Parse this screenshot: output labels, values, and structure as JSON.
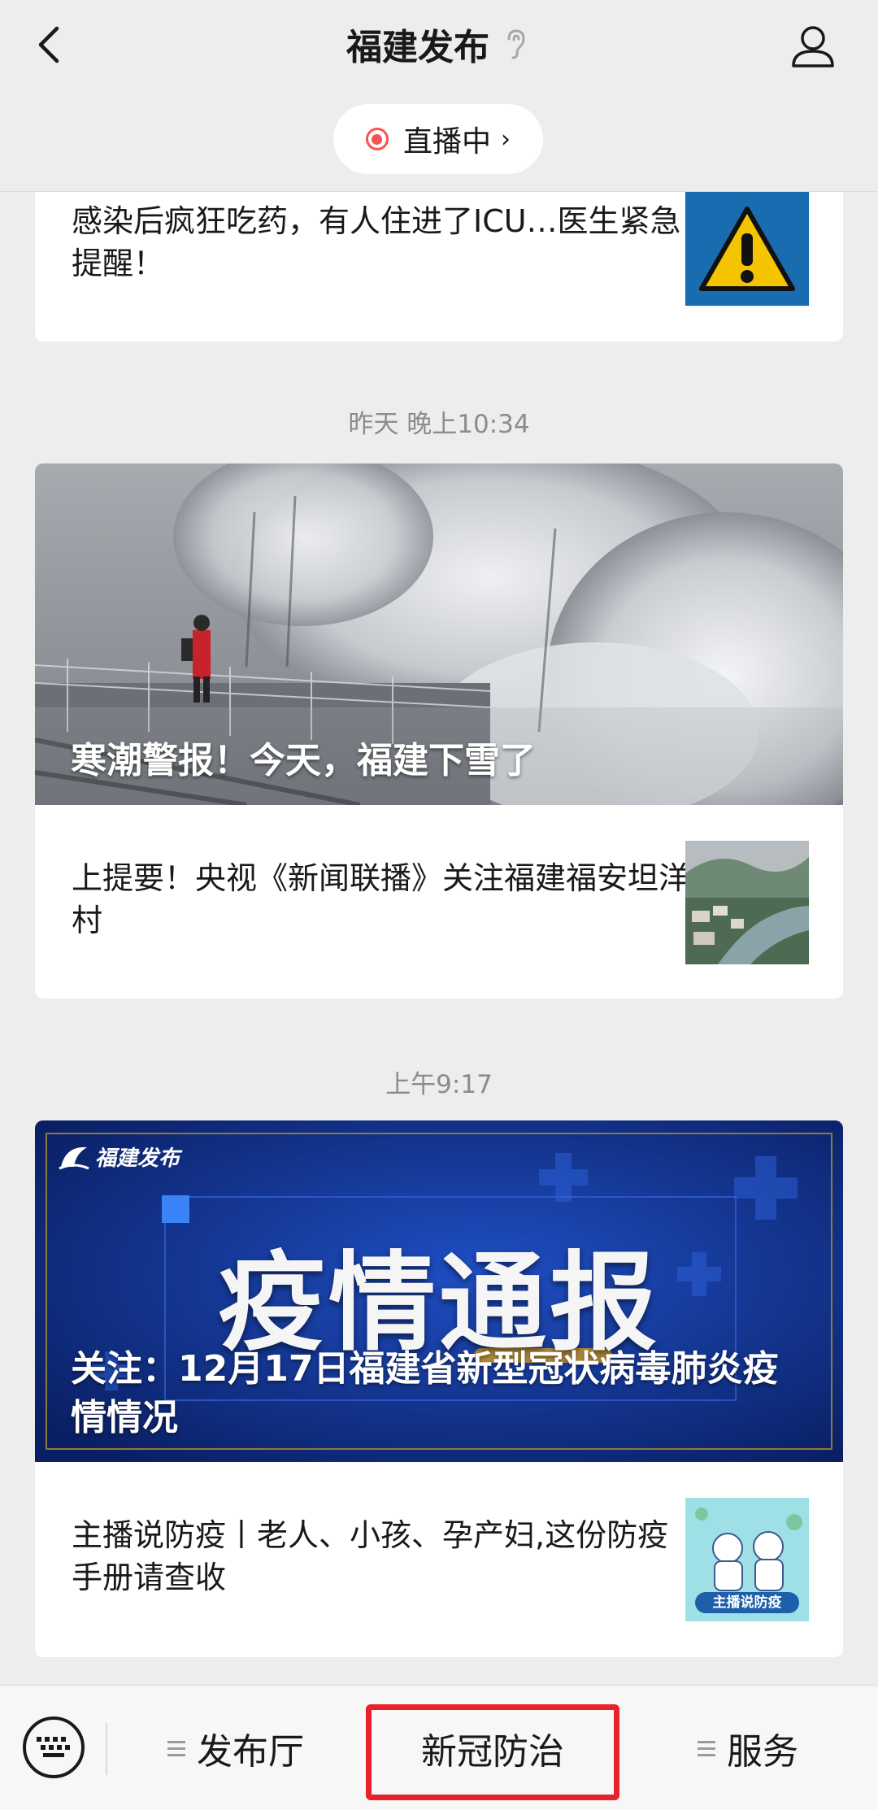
{
  "header": {
    "title": "福建发布",
    "live_label": "直播中",
    "live_chevron": "›"
  },
  "feed": {
    "partial_item": {
      "text": "感染后疯狂吃药，有人住进了ICU…医生紧急提醒！",
      "thumb_icon": "warning-icon"
    },
    "groups": [
      {
        "time": "昨天 晚上10:34",
        "hero_title": "寒潮警报！今天，福建下雪了",
        "item_text": "上提要！央视《新闻联播》关注福建福安坦洋村"
      },
      {
        "time": "上午9:17",
        "hero_logo": "福建发布",
        "hero_banner": "疫情通报",
        "hero_title": "关注：12月17日福建省新型冠状病毒肺炎疫情情况",
        "item_text": "主播说防疫丨老人、小孩、孕产妇,这份防疫手册请查收",
        "item_thumb_label": "主播说防疫"
      }
    ]
  },
  "bottom_menu": {
    "items": [
      {
        "label": "发布厅",
        "has_submenu": true
      },
      {
        "label": "新冠防治",
        "has_submenu": false
      },
      {
        "label": "服务",
        "has_submenu": true
      }
    ],
    "highlight_color": "#e8212a"
  },
  "colors": {
    "live_dot": "#fa5151",
    "background": "#ededed",
    "hero_blue": "#0d2a80"
  }
}
